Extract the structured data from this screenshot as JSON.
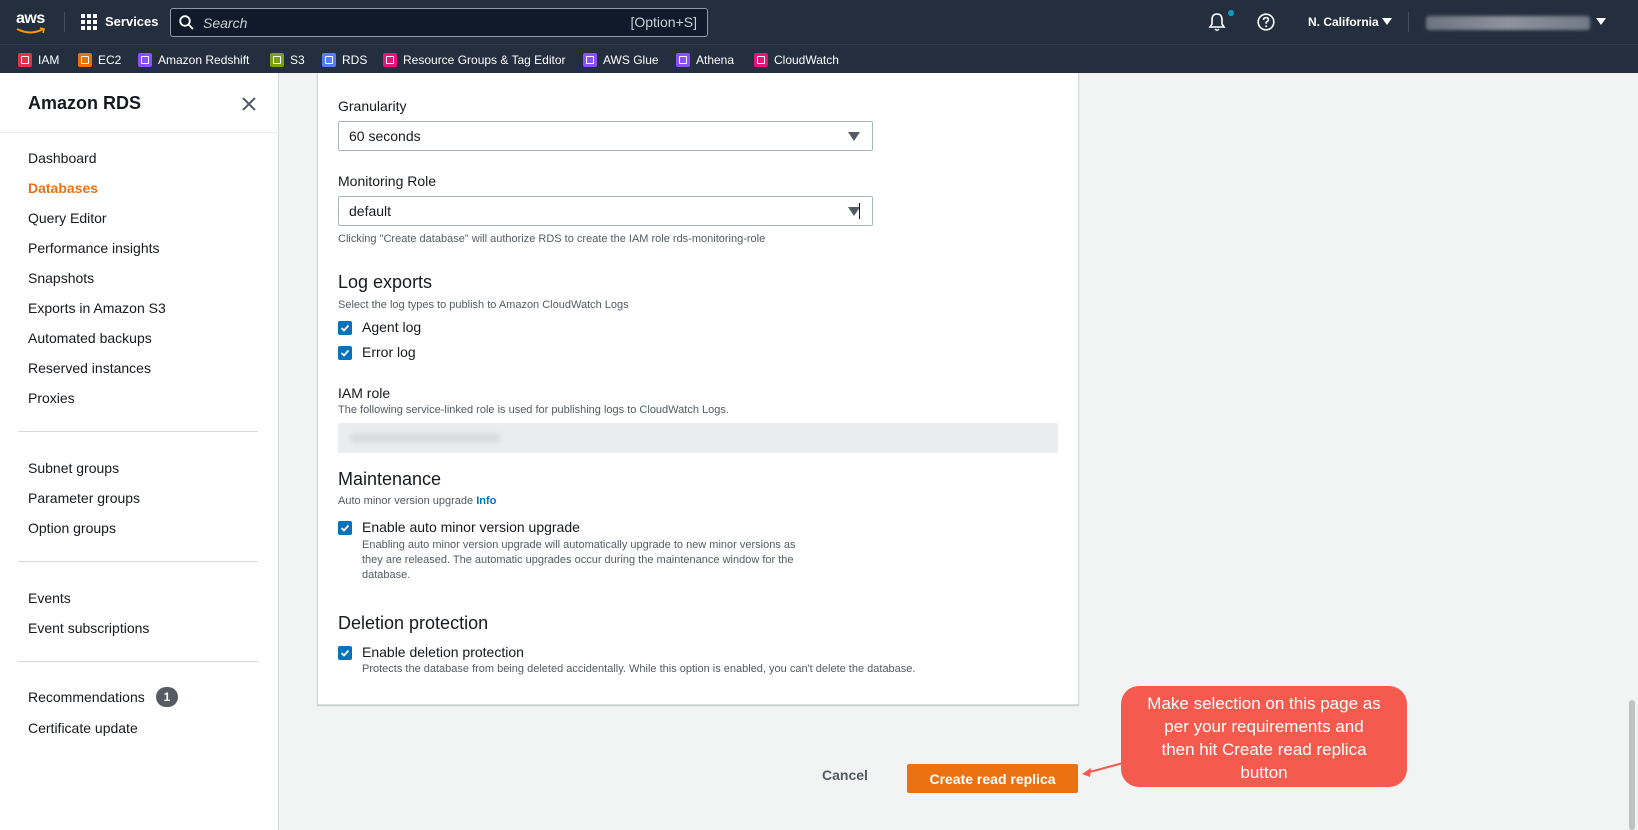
{
  "topbar": {
    "logo_text": "aws",
    "services_label": "Services",
    "search_placeholder": "Search",
    "search_shortcut": "[Option+S]",
    "region": "N. California"
  },
  "favorites": [
    {
      "label": "IAM",
      "color": "#dd344c"
    },
    {
      "label": "EC2",
      "color": "#ed7100"
    },
    {
      "label": "Amazon Redshift",
      "color": "#8c4fff"
    },
    {
      "label": "S3",
      "color": "#7aa116"
    },
    {
      "label": "RDS",
      "color": "#527fff"
    },
    {
      "label": "Resource Groups & Tag Editor",
      "color": "#e7157b"
    },
    {
      "label": "AWS Glue",
      "color": "#8c4fff"
    },
    {
      "label": "Athena",
      "color": "#8c4fff"
    },
    {
      "label": "CloudWatch",
      "color": "#e7157b"
    }
  ],
  "sidebar": {
    "title": "Amazon RDS",
    "items": [
      "Dashboard",
      "Databases",
      "Query Editor",
      "Performance insights",
      "Snapshots",
      "Exports in Amazon S3",
      "Automated backups",
      "Reserved instances",
      "Proxies",
      "Subnet groups",
      "Parameter groups",
      "Option groups",
      "Events",
      "Event subscriptions",
      "Recommendations",
      "Certificate update"
    ],
    "recommendations_badge": "1"
  },
  "form": {
    "granularity_label": "Granularity",
    "granularity_value": "60 seconds",
    "monitoring_role_label": "Monitoring Role",
    "monitoring_role_value": "default",
    "monitoring_role_hint": "Clicking \"Create database\" will authorize RDS to create the IAM role rds-monitoring-role",
    "log_exports_title": "Log exports",
    "log_exports_hint": "Select the log types to publish to Amazon CloudWatch Logs",
    "agent_log": "Agent log",
    "error_log": "Error log",
    "iam_role_label": "IAM role",
    "iam_role_hint": "The following service-linked role is used for publishing logs to CloudWatch Logs.",
    "maintenance_title": "Maintenance",
    "maintenance_hint": "Auto minor version upgrade",
    "info_link": "Info",
    "auto_upgrade_label": "Enable auto minor version upgrade",
    "auto_upgrade_desc_1": "Enabling auto minor version upgrade will automatically upgrade to new minor versions as",
    "auto_upgrade_desc_2": "they are released. The automatic upgrades occur during the maintenance window for the",
    "auto_upgrade_desc_3": "database.",
    "deletion_title": "Deletion protection",
    "deletion_label": "Enable deletion protection",
    "deletion_desc": "Protects the database from being deleted accidentally. While this option is enabled, you can't delete the database."
  },
  "actions": {
    "cancel": "Cancel",
    "create": "Create read replica"
  },
  "callout": {
    "line1": "Make selection on this page as",
    "line2": "per your requirements and",
    "line3": "then hit Create read replica",
    "line4": "button"
  }
}
